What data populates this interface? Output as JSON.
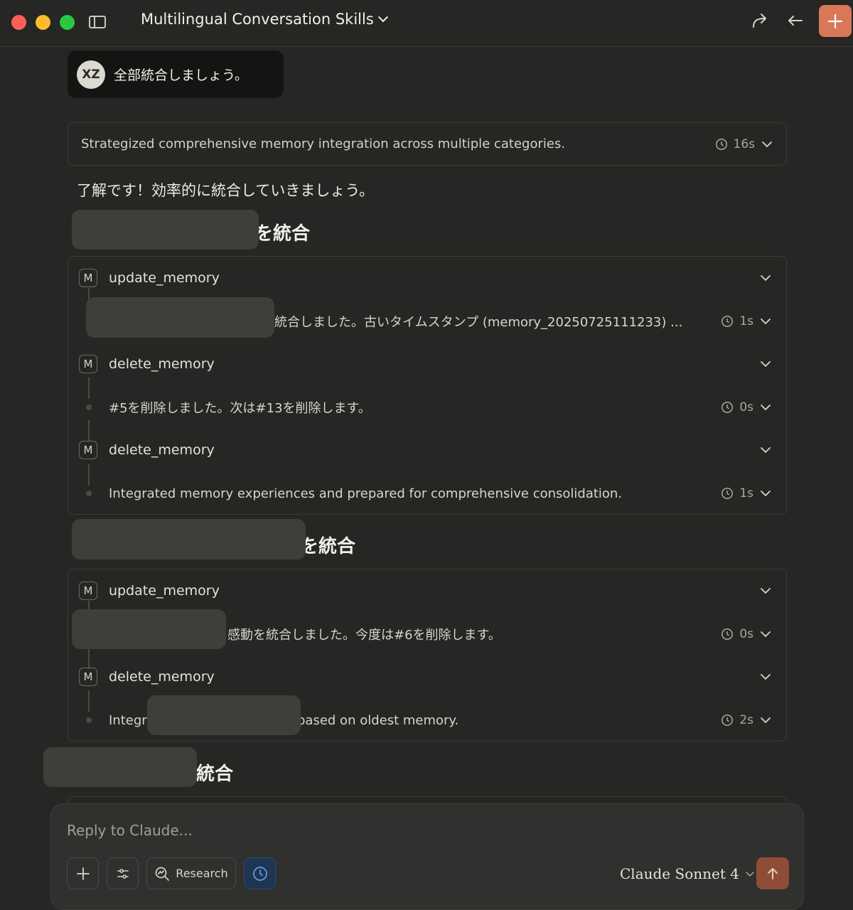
{
  "window": {
    "title": "Multilingual Conversation Skills"
  },
  "user_message": {
    "avatar_initials": "XZ",
    "text": "全部統合しましょう。"
  },
  "thinking": {
    "summary": "Strategized comprehensive memory integration across multiple categories.",
    "duration": "16s"
  },
  "assistant": {
    "intro": "了解です！効率的に統合していきましょう。",
    "sections": [
      {
        "heading_visible": "を統合",
        "tools": [
          {
            "badge": "M",
            "name": "update_memory",
            "result": "統合しました。古いタイムスタンプ (memory_20250725111233) ...",
            "duration": "1s"
          },
          {
            "badge": "M",
            "name": "delete_memory",
            "result": "#5を削除しました。次は#13を削除します。",
            "duration": "0s"
          },
          {
            "badge": "M",
            "name": "delete_memory",
            "result": "Integrated memory experiences and prepared for comprehensive consolidation.",
            "duration": "1s"
          }
        ]
      },
      {
        "heading_visible": "を統合",
        "tools": [
          {
            "badge": "M",
            "name": "update_memory",
            "result": "感動を統合しました。今度は#6を削除します。",
            "duration": "0s"
          },
          {
            "badge": "M",
            "name": "delete_memory",
            "result_prefix": "Integr",
            "result_suffix": "based on oldest memory.",
            "duration": "2s"
          }
        ]
      },
      {
        "heading_visible": "統合"
      }
    ]
  },
  "composer": {
    "placeholder": "Reply to Claude...",
    "research_label": "Research",
    "model": "Claude Sonnet 4"
  },
  "colors": {
    "accent": "#d97757",
    "background": "#262624",
    "history_active": "#1f3550"
  }
}
